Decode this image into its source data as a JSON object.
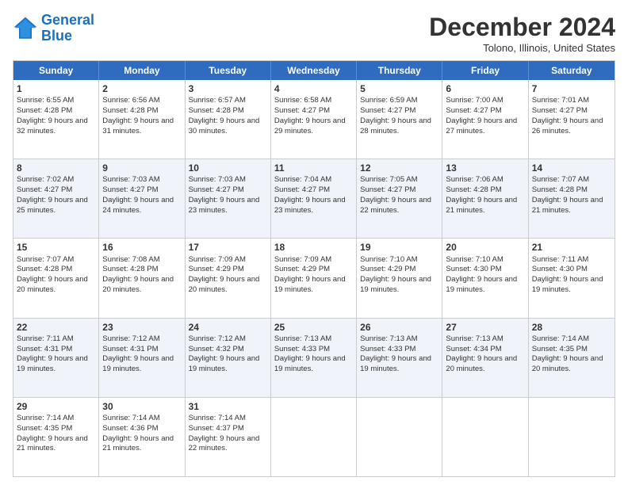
{
  "logo": {
    "line1": "General",
    "line2": "Blue"
  },
  "title": "December 2024",
  "location": "Tolono, Illinois, United States",
  "dayHeaders": [
    "Sunday",
    "Monday",
    "Tuesday",
    "Wednesday",
    "Thursday",
    "Friday",
    "Saturday"
  ],
  "rows": [
    [
      {
        "day": "1",
        "sunrise": "Sunrise: 6:55 AM",
        "sunset": "Sunset: 4:28 PM",
        "daylight": "Daylight: 9 hours and 32 minutes."
      },
      {
        "day": "2",
        "sunrise": "Sunrise: 6:56 AM",
        "sunset": "Sunset: 4:28 PM",
        "daylight": "Daylight: 9 hours and 31 minutes."
      },
      {
        "day": "3",
        "sunrise": "Sunrise: 6:57 AM",
        "sunset": "Sunset: 4:28 PM",
        "daylight": "Daylight: 9 hours and 30 minutes."
      },
      {
        "day": "4",
        "sunrise": "Sunrise: 6:58 AM",
        "sunset": "Sunset: 4:27 PM",
        "daylight": "Daylight: 9 hours and 29 minutes."
      },
      {
        "day": "5",
        "sunrise": "Sunrise: 6:59 AM",
        "sunset": "Sunset: 4:27 PM",
        "daylight": "Daylight: 9 hours and 28 minutes."
      },
      {
        "day": "6",
        "sunrise": "Sunrise: 7:00 AM",
        "sunset": "Sunset: 4:27 PM",
        "daylight": "Daylight: 9 hours and 27 minutes."
      },
      {
        "day": "7",
        "sunrise": "Sunrise: 7:01 AM",
        "sunset": "Sunset: 4:27 PM",
        "daylight": "Daylight: 9 hours and 26 minutes."
      }
    ],
    [
      {
        "day": "8",
        "sunrise": "Sunrise: 7:02 AM",
        "sunset": "Sunset: 4:27 PM",
        "daylight": "Daylight: 9 hours and 25 minutes."
      },
      {
        "day": "9",
        "sunrise": "Sunrise: 7:03 AM",
        "sunset": "Sunset: 4:27 PM",
        "daylight": "Daylight: 9 hours and 24 minutes."
      },
      {
        "day": "10",
        "sunrise": "Sunrise: 7:03 AM",
        "sunset": "Sunset: 4:27 PM",
        "daylight": "Daylight: 9 hours and 23 minutes."
      },
      {
        "day": "11",
        "sunrise": "Sunrise: 7:04 AM",
        "sunset": "Sunset: 4:27 PM",
        "daylight": "Daylight: 9 hours and 23 minutes."
      },
      {
        "day": "12",
        "sunrise": "Sunrise: 7:05 AM",
        "sunset": "Sunset: 4:27 PM",
        "daylight": "Daylight: 9 hours and 22 minutes."
      },
      {
        "day": "13",
        "sunrise": "Sunrise: 7:06 AM",
        "sunset": "Sunset: 4:28 PM",
        "daylight": "Daylight: 9 hours and 21 minutes."
      },
      {
        "day": "14",
        "sunrise": "Sunrise: 7:07 AM",
        "sunset": "Sunset: 4:28 PM",
        "daylight": "Daylight: 9 hours and 21 minutes."
      }
    ],
    [
      {
        "day": "15",
        "sunrise": "Sunrise: 7:07 AM",
        "sunset": "Sunset: 4:28 PM",
        "daylight": "Daylight: 9 hours and 20 minutes."
      },
      {
        "day": "16",
        "sunrise": "Sunrise: 7:08 AM",
        "sunset": "Sunset: 4:28 PM",
        "daylight": "Daylight: 9 hours and 20 minutes."
      },
      {
        "day": "17",
        "sunrise": "Sunrise: 7:09 AM",
        "sunset": "Sunset: 4:29 PM",
        "daylight": "Daylight: 9 hours and 20 minutes."
      },
      {
        "day": "18",
        "sunrise": "Sunrise: 7:09 AM",
        "sunset": "Sunset: 4:29 PM",
        "daylight": "Daylight: 9 hours and 19 minutes."
      },
      {
        "day": "19",
        "sunrise": "Sunrise: 7:10 AM",
        "sunset": "Sunset: 4:29 PM",
        "daylight": "Daylight: 9 hours and 19 minutes."
      },
      {
        "day": "20",
        "sunrise": "Sunrise: 7:10 AM",
        "sunset": "Sunset: 4:30 PM",
        "daylight": "Daylight: 9 hours and 19 minutes."
      },
      {
        "day": "21",
        "sunrise": "Sunrise: 7:11 AM",
        "sunset": "Sunset: 4:30 PM",
        "daylight": "Daylight: 9 hours and 19 minutes."
      }
    ],
    [
      {
        "day": "22",
        "sunrise": "Sunrise: 7:11 AM",
        "sunset": "Sunset: 4:31 PM",
        "daylight": "Daylight: 9 hours and 19 minutes."
      },
      {
        "day": "23",
        "sunrise": "Sunrise: 7:12 AM",
        "sunset": "Sunset: 4:31 PM",
        "daylight": "Daylight: 9 hours and 19 minutes."
      },
      {
        "day": "24",
        "sunrise": "Sunrise: 7:12 AM",
        "sunset": "Sunset: 4:32 PM",
        "daylight": "Daylight: 9 hours and 19 minutes."
      },
      {
        "day": "25",
        "sunrise": "Sunrise: 7:13 AM",
        "sunset": "Sunset: 4:33 PM",
        "daylight": "Daylight: 9 hours and 19 minutes."
      },
      {
        "day": "26",
        "sunrise": "Sunrise: 7:13 AM",
        "sunset": "Sunset: 4:33 PM",
        "daylight": "Daylight: 9 hours and 19 minutes."
      },
      {
        "day": "27",
        "sunrise": "Sunrise: 7:13 AM",
        "sunset": "Sunset: 4:34 PM",
        "daylight": "Daylight: 9 hours and 20 minutes."
      },
      {
        "day": "28",
        "sunrise": "Sunrise: 7:14 AM",
        "sunset": "Sunset: 4:35 PM",
        "daylight": "Daylight: 9 hours and 20 minutes."
      }
    ],
    [
      {
        "day": "29",
        "sunrise": "Sunrise: 7:14 AM",
        "sunset": "Sunset: 4:35 PM",
        "daylight": "Daylight: 9 hours and 21 minutes."
      },
      {
        "day": "30",
        "sunrise": "Sunrise: 7:14 AM",
        "sunset": "Sunset: 4:36 PM",
        "daylight": "Daylight: 9 hours and 21 minutes."
      },
      {
        "day": "31",
        "sunrise": "Sunrise: 7:14 AM",
        "sunset": "Sunset: 4:37 PM",
        "daylight": "Daylight: 9 hours and 22 minutes."
      },
      null,
      null,
      null,
      null
    ]
  ],
  "altRows": [
    1,
    3
  ]
}
